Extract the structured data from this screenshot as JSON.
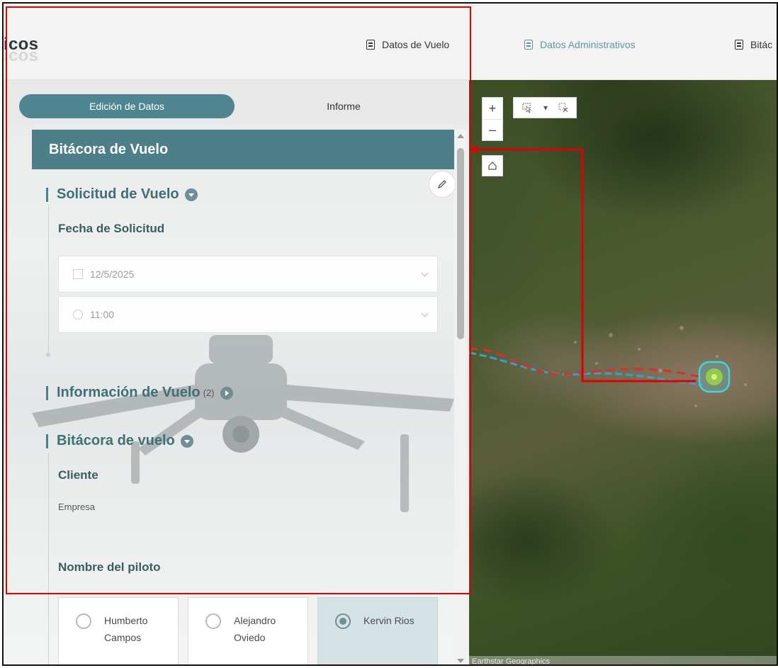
{
  "header": {
    "brand": "icos",
    "nav": [
      {
        "label": "Datos de Vuelo",
        "active": false
      },
      {
        "label": "Datos Administrativos",
        "active": true
      },
      {
        "label": "Bitác",
        "active": false
      }
    ]
  },
  "panel": {
    "tabs": {
      "edit": "Edición de Datos",
      "report": "Informe"
    },
    "form_title": "Bitácora de Vuelo",
    "sections": {
      "solicitud": {
        "title": "Solicitud de Vuelo",
        "field_label": "Fecha de Solicitud",
        "date": "12/5/2025",
        "time": "11:00"
      },
      "informacion": {
        "title": "Información de Vuelo",
        "count": "(2)"
      },
      "bitacora": {
        "title": "Bitácora de vuelo",
        "cliente_label": "Cliente",
        "cliente_value": "Empresa",
        "piloto_label": "Nombre del piloto"
      }
    },
    "pilots": [
      {
        "line1": "Humberto",
        "line2": "Campos",
        "selected": false
      },
      {
        "line1": "Alejandro",
        "line2": "Oviedo",
        "selected": false
      },
      {
        "line1": "Kervin Rios",
        "line2": "",
        "selected": true
      }
    ]
  },
  "map": {
    "zoom_in": "+",
    "zoom_out": "–",
    "attribution": "Earthstar Geographics"
  },
  "colors": {
    "accent": "#4d7f88",
    "highlight": "#e00000",
    "route_blue": "#3a9fd0",
    "route_red": "#d9302a",
    "marker": "#3fd6e0"
  }
}
